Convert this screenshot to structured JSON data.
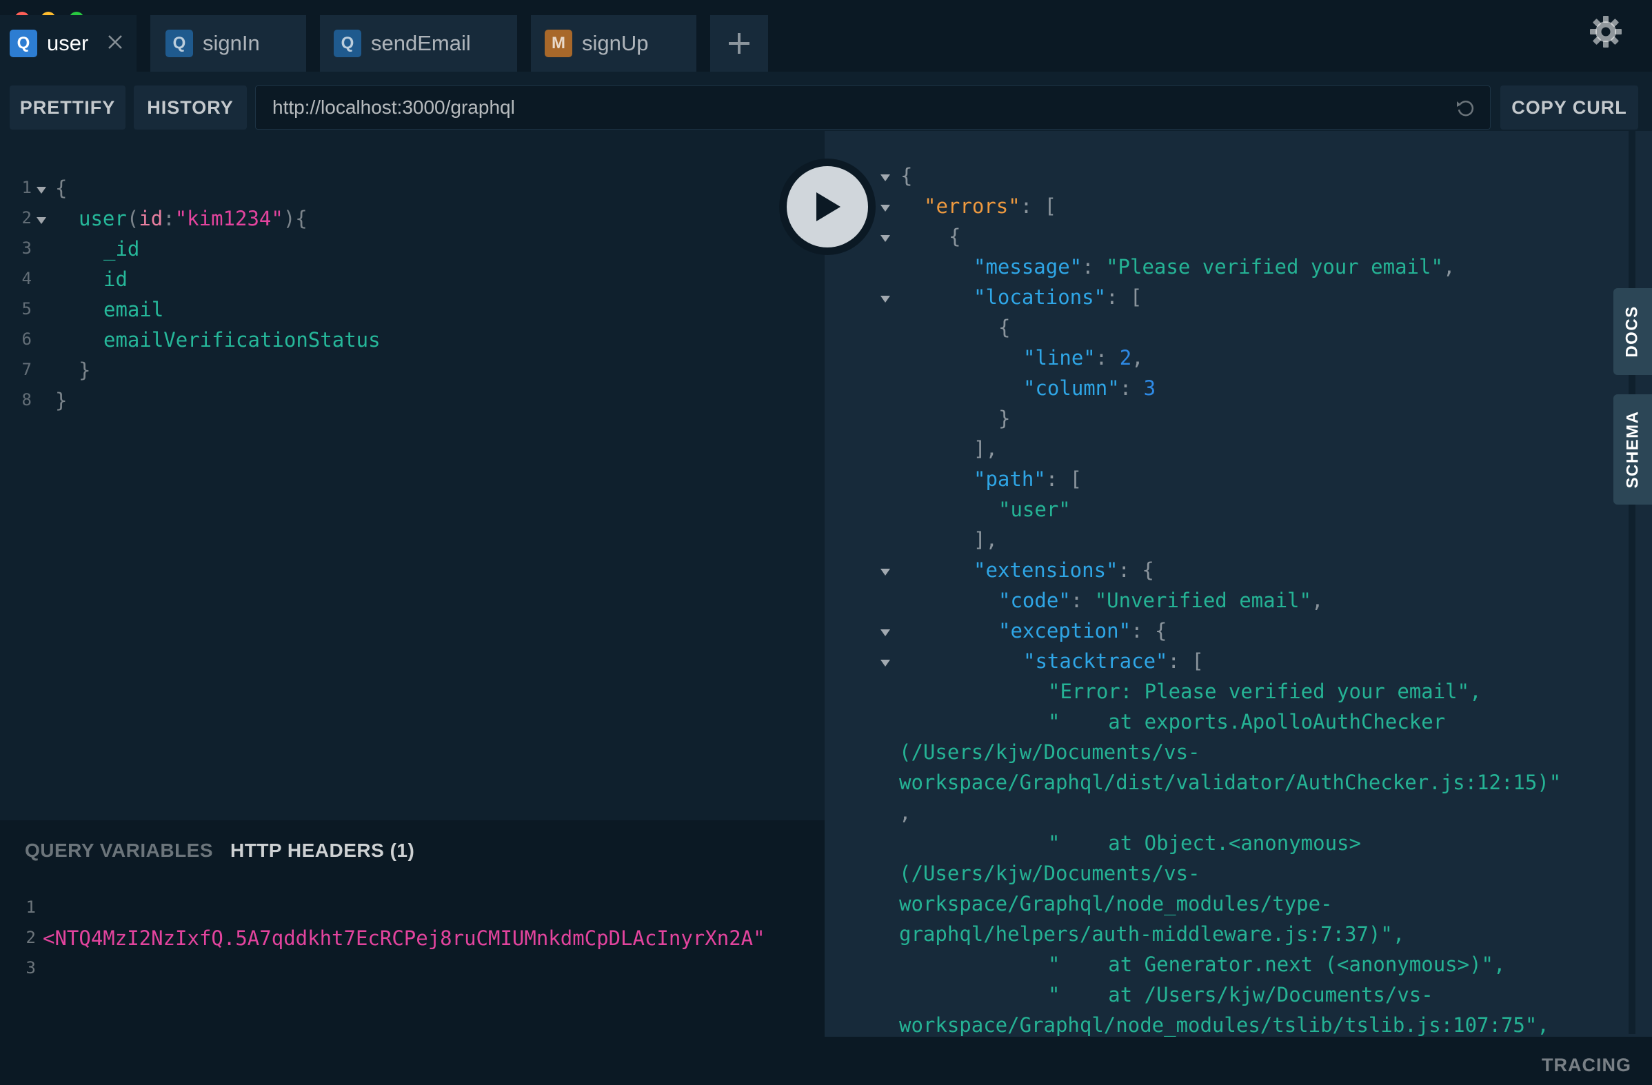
{
  "tabs": [
    {
      "badge": "Q",
      "label": "user",
      "active": true
    },
    {
      "badge": "Q",
      "label": "signIn"
    },
    {
      "badge": "Q",
      "label": "sendEmail"
    },
    {
      "badge": "M",
      "label": "signUp"
    }
  ],
  "toolbar": {
    "prettify_label": "PRETTIFY",
    "history_label": "HISTORY",
    "endpoint_url": "http://localhost:3000/graphql",
    "copy_curl_label": "COPY CURL"
  },
  "editor": {
    "line_numbers": [
      "1",
      "2",
      "3",
      "4",
      "5",
      "6",
      "7",
      "8"
    ],
    "brace_open": "{",
    "query_field": "user",
    "paren_open": "(",
    "arg_name": "id",
    "colon": ":",
    "arg_value": "\"kim1234\"",
    "paren_close_brace": "){",
    "fields": [
      "_id",
      "id",
      "email",
      "emailVerificationStatus"
    ],
    "inner_close": "}",
    "outer_close": "}"
  },
  "variables": {
    "tab_query_variables": "QUERY VARIABLES",
    "tab_http_headers": "HTTP HEADERS (1)",
    "line_numbers": [
      "1",
      "2",
      "3"
    ],
    "header_value_visible": "<NTQ4MzI2NzIxfQ.5A7qddkht7EcRCPej8ruCMIUMnkdmCpDLAcInyrXn2A\""
  },
  "result": {
    "lines": {
      "l1": "{",
      "errors_key": "\"errors\"",
      "l2_rest": ": [",
      "l3": "{",
      "message_key": "\"message\"",
      "message_val": "\"Please verified your email\"",
      "locations_key": "\"locations\"",
      "l5_rest": ": [",
      "l6": "{",
      "line_key": "\"line\"",
      "line_val": "2",
      "column_key": "\"column\"",
      "column_val": "3",
      "l9": "}",
      "l10": "],",
      "path_key": "\"path\"",
      "l11_rest": ": [",
      "path_val": "\"user\"",
      "l13": "],",
      "extensions_key": "\"extensions\"",
      "l14_rest": ": {",
      "code_key": "\"code\"",
      "code_val": "\"Unverified email\"",
      "exception_key": "\"exception\"",
      "l16_rest": ": {",
      "stacktrace_key": "\"stacktrace\"",
      "l17_rest": ": [",
      "st1": "\"Error: Please verified your email\",",
      "st2a": "\"    at exports.ApolloAuthChecker",
      "st2b": "(/Users/kjw/Documents/vs-",
      "st2c": "workspace/Graphql/dist/validator/AuthChecker.js:12:15)\"",
      "st2d": ",",
      "st3a": "\"    at Object.<anonymous>",
      "st3b": "(/Users/kjw/Documents/vs-",
      "st3c": "workspace/Graphql/node_modules/type-",
      "st3d": "graphql/helpers/auth-middleware.js:7:37)\",",
      "st4": "\"    at Generator.next (<anonymous>)\",",
      "st5a": "\"    at /Users/kjw/Documents/vs-",
      "st5b": "workspace/Graphql/node_modules/tslib/tslib.js:107:75\","
    }
  },
  "side_tabs": {
    "docs": "DOCS",
    "schema": "SCHEMA"
  },
  "footer": {
    "tracing_label": "TRACING"
  },
  "colors": {
    "query_badge": "#1f5a8e",
    "query_badge_active": "#2d7dd2",
    "mutation_badge": "#a8682a",
    "background": "#0f202d",
    "result_background": "#172a3a"
  },
  "icons": [
    "close-icon",
    "plus-icon",
    "gear-icon",
    "reload-icon",
    "play-icon",
    "fold-arrow-icon"
  ]
}
